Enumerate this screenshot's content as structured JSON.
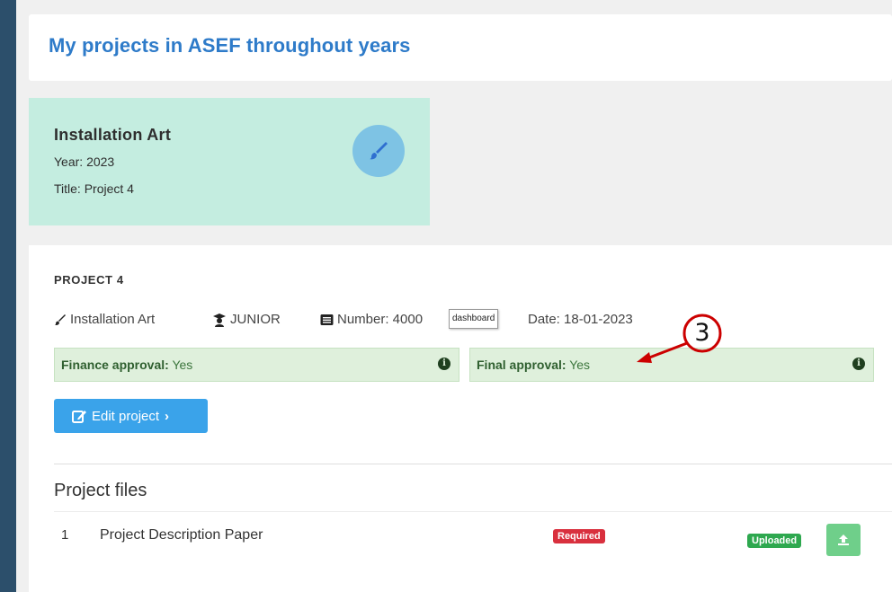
{
  "header": {
    "title": "My projects in ASEF throughout years"
  },
  "project_card": {
    "category": "Installation Art",
    "year": "Year: 2023",
    "title": "Title: Project 4",
    "icon": "paintbrush-icon"
  },
  "project": {
    "heading": "PROJECT 4",
    "category": "Installation Art",
    "level": "JUNIOR",
    "number": "Number: 4000",
    "date": "Date: 18-01-2023",
    "tooltip": "dashboard",
    "finance_label": "Finance approval:",
    "finance_value": "Yes",
    "final_label": "Final approval:",
    "final_value": "Yes",
    "info_icon": "i",
    "edit_label": "Edit project"
  },
  "files": {
    "heading": "Project files",
    "rows": [
      {
        "num": "1",
        "name": "Project Description Paper",
        "required": "Required",
        "status": "Uploaded"
      }
    ]
  },
  "annotation": {
    "label": "3",
    "color": "#cc0000"
  },
  "colors": {
    "title": "#2e7bc9",
    "card_bg": "#c4ede0",
    "approval_bg": "#dff0dc",
    "primary_btn": "#3aa3ea",
    "required": "#d9303e",
    "uploaded": "#2ea84f"
  }
}
